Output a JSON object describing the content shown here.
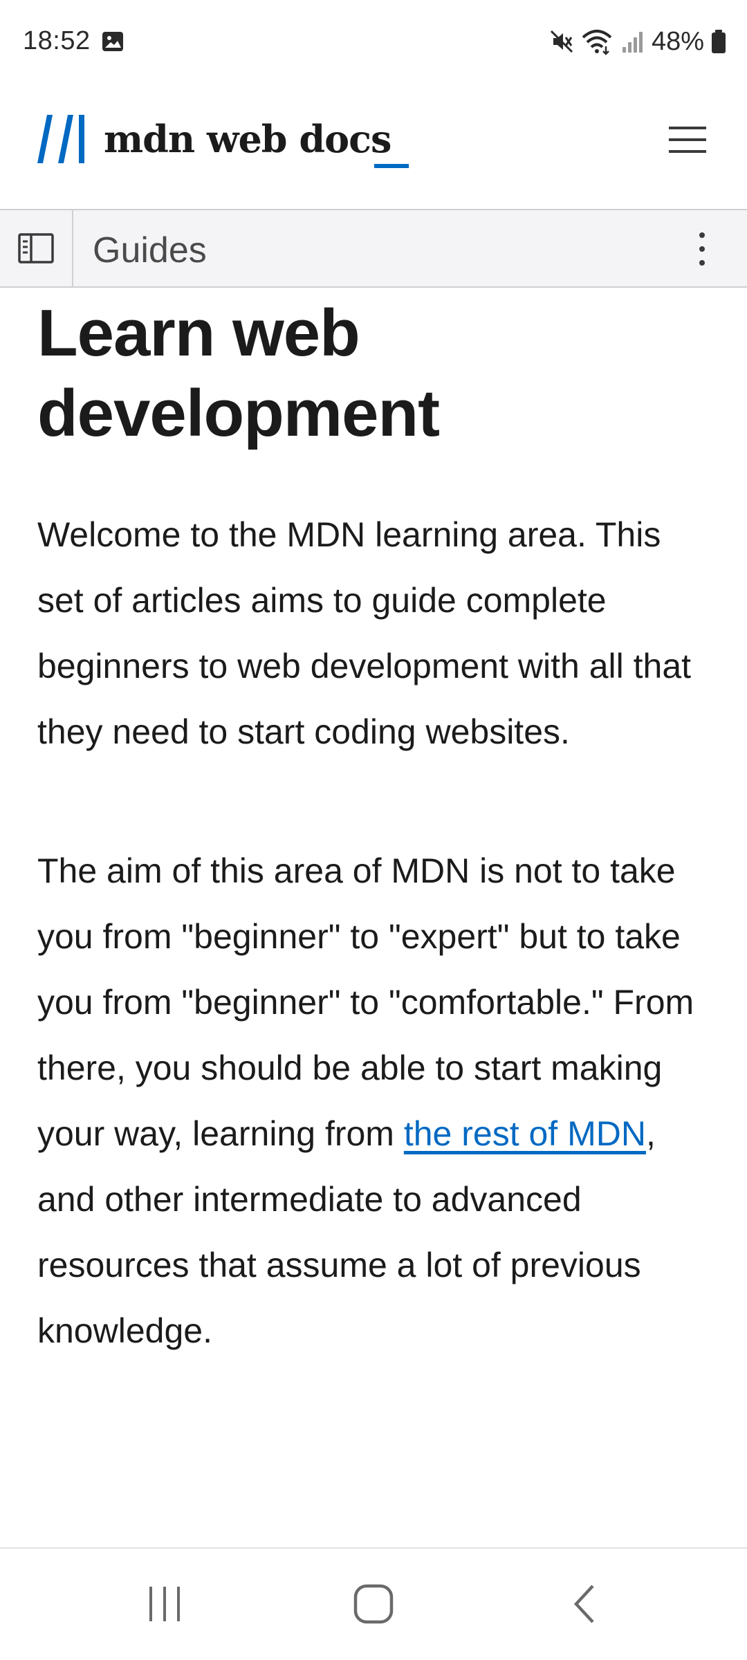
{
  "status_bar": {
    "time": "18:52",
    "battery": "48%",
    "icons": [
      "photo-icon",
      "mute-icon",
      "wifi-icon",
      "signal-icon",
      "battery-icon"
    ]
  },
  "header": {
    "logo_text": "mdn web docs",
    "brand_color": "#0069c2",
    "menu_icon": "hamburger-menu-icon"
  },
  "toolbar": {
    "title": "Guides",
    "sidebar_icon": "sidebar-toggle-icon",
    "more_icon": "more-vertical-icon"
  },
  "article": {
    "title": "Learn web development",
    "paragraph1": "Welcome to the MDN learning area. This set of articles aims to guide complete beginners to web development with all that they need to start coding websites.",
    "paragraph2_before": "The aim of this area of MDN is not to take you from \"beginner\" to \"expert\" but to take you from \"beginner\" to \"comfortable.\" From there, you should be able to start making your way, learning from ",
    "paragraph2_link": "the rest of MDN",
    "paragraph2_after": ", and other intermediate to advanced resources that assume a lot of previous knowledge."
  },
  "nav_bar": {
    "icons": [
      "recent-apps-icon",
      "home-icon",
      "back-icon"
    ]
  }
}
